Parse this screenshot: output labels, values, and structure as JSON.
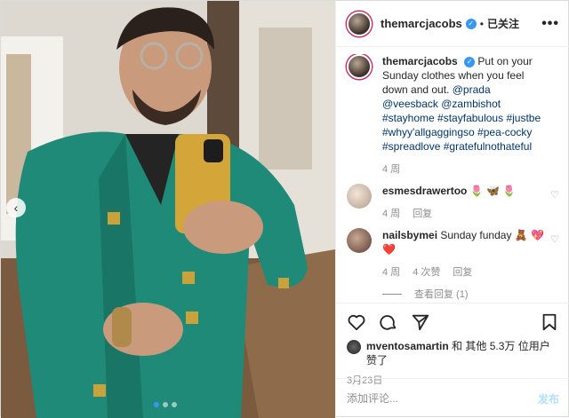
{
  "header": {
    "username": "themarcjacobs",
    "separator": "•",
    "follow_label": "已关注",
    "more_label": "•••"
  },
  "caption": {
    "username": "themarcjacobs",
    "text": "Put on your Sunday clothes when you feel down and out.",
    "tags": [
      "@prada",
      "@veesback",
      "@zambishot",
      "#stayhome",
      "#stayfabulous",
      "#justbe",
      "#whyy'allgaggingso",
      "#pea-cocky",
      "#spreadlove",
      "#gratefulnothateful"
    ],
    "time": "4 周"
  },
  "comments": [
    {
      "username": "esmesdrawertoo",
      "text": "🌷 🦋 🌷",
      "time": "4 周",
      "reply_label": "回复",
      "likes": ""
    },
    {
      "username": "nailsbymei",
      "text": "Sunday funday 🧸 💖❤️",
      "time": "4 周",
      "likes": "4 次赞",
      "reply_label": "回复"
    }
  ],
  "view_replies_label": "查看回复 (1)",
  "likes_line": {
    "user": "mventosamartin",
    "rest": " 和 其他 5.3万 位用户赞了"
  },
  "date": "3月23日",
  "add_comment": {
    "placeholder": "添加评论...",
    "post_label": "发布"
  },
  "icons": [
    "heart-icon",
    "comment-icon",
    "share-icon",
    "bookmark-icon"
  ],
  "colors": {
    "accent": "#3897f0",
    "jacket": "#1f8a78",
    "link": "#003569"
  }
}
